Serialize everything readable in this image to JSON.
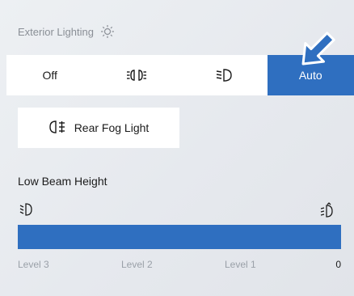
{
  "header": {
    "title": "Exterior Lighting",
    "icon": "sun-icon"
  },
  "modes": {
    "options": [
      {
        "label": "Off",
        "icon": null
      },
      {
        "label": "",
        "icon": "parking-lights-icon"
      },
      {
        "label": "",
        "icon": "low-beam-icon"
      },
      {
        "label": "Auto",
        "icon": null
      }
    ],
    "selected": "Auto",
    "accent": "#2f6fc0"
  },
  "fog": {
    "label": "Rear Fog Light",
    "icon": "rear-fog-light-icon"
  },
  "beam": {
    "title": "Low Beam Height",
    "low_icon": "beam-level-low-icon",
    "high_icon": "beam-level-high-icon",
    "levels": [
      "Level 3",
      "Level 2",
      "Level 1",
      "0"
    ],
    "current": "0",
    "fill_fraction": 1.0
  }
}
